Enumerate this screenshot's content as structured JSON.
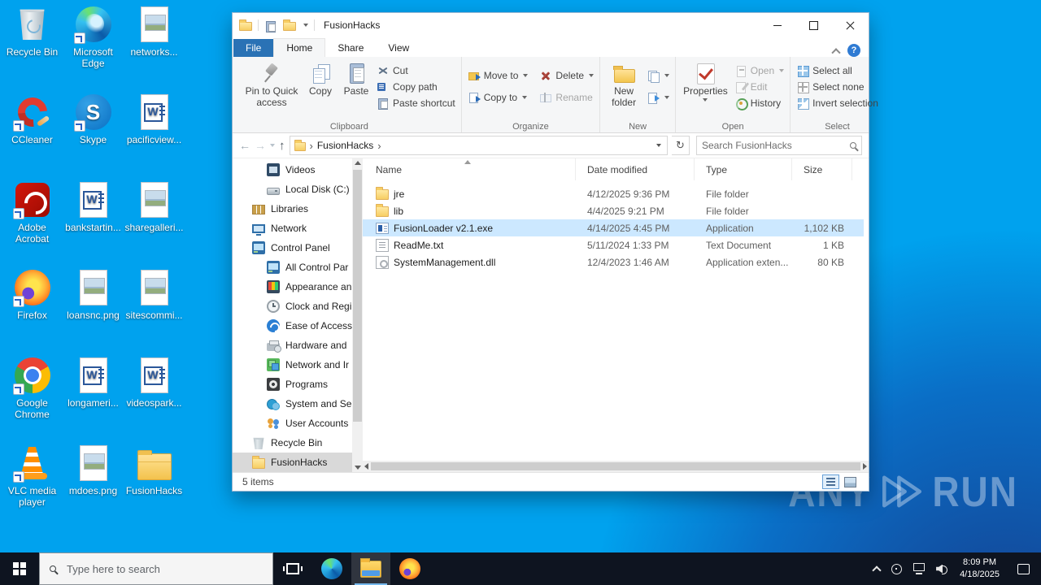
{
  "desktop": {
    "icons": [
      {
        "label": "Recycle Bin",
        "icon": "recycle-bin"
      },
      {
        "label": "Microsoft Edge",
        "icon": "edge",
        "state": "shortcut"
      },
      {
        "label": "networks...",
        "icon": "image"
      },
      {
        "label": "CCleaner",
        "icon": "ccleaner",
        "state": "shortcut"
      },
      {
        "label": "Skype",
        "icon": "skype",
        "state": "shortcut"
      },
      {
        "label": "pacificview...",
        "icon": "word"
      },
      {
        "label": "Adobe Acrobat",
        "icon": "acrobat",
        "state": "shortcut"
      },
      {
        "label": "bankstartin...",
        "icon": "word"
      },
      {
        "label": "sharegalleri...",
        "icon": "image"
      },
      {
        "label": "Firefox",
        "icon": "firefox",
        "state": "shortcut"
      },
      {
        "label": "loansnc.png",
        "icon": "image"
      },
      {
        "label": "sitescommi...",
        "icon": "image"
      },
      {
        "label": "Google Chrome",
        "icon": "chrome",
        "state": "shortcut"
      },
      {
        "label": "longameri...",
        "icon": "word"
      },
      {
        "label": "videospark...",
        "icon": "word"
      },
      {
        "label": "VLC media player",
        "icon": "vlc",
        "state": "shortcut"
      },
      {
        "label": "mdoes.png",
        "icon": "image"
      },
      {
        "label": "FusionHacks",
        "icon": "folder"
      }
    ]
  },
  "window": {
    "title": "FusionHacks",
    "help": "?",
    "tabs": {
      "file": "File",
      "home": "Home",
      "share": "Share",
      "view": "View"
    },
    "ribbon": {
      "clipboard": {
        "label": "Clipboard",
        "pin": {
          "label": "Pin to Quick access",
          "icon": "pin"
        },
        "copy": {
          "label": "Copy",
          "icon": "copy-pages"
        },
        "paste": {
          "label": "Paste",
          "icon": "clipboard-paste"
        },
        "cut": {
          "label": "Cut",
          "icon": "scissors"
        },
        "copy_path": {
          "label": "Copy path",
          "icon": "copy-path"
        },
        "paste_shortcut": {
          "label": "Paste shortcut",
          "icon": "paste-shortcut"
        }
      },
      "organize": {
        "label": "Organize",
        "move_to": {
          "label": "Move to",
          "icon": "move-to-folder"
        },
        "copy_to": {
          "label": "Copy to",
          "icon": "copy-to-folder"
        },
        "delete": {
          "label": "Delete",
          "icon": "delete-x"
        },
        "rename": {
          "label": "Rename",
          "icon": "rename-field"
        }
      },
      "new": {
        "label": "New",
        "new_folder": {
          "label": "New folder",
          "icon": "new-folder"
        },
        "new_item_icon": "new-item",
        "easy_access_icon": "easy-access"
      },
      "open": {
        "label": "Open",
        "properties": {
          "label": "Properties",
          "icon": "properties-check"
        },
        "open": {
          "label": "Open",
          "icon": "open-file"
        },
        "edit": {
          "label": "Edit",
          "icon": "edit-pencil"
        },
        "history": {
          "label": "History",
          "icon": "history-clock"
        }
      },
      "select": {
        "label": "Select",
        "select_all": {
          "label": "Select all",
          "icon": "grid-filled"
        },
        "select_none": {
          "label": "Select none",
          "icon": "grid-outline"
        },
        "invert": {
          "label": "Invert selection",
          "icon": "grid-half"
        }
      }
    },
    "address": {
      "crumb": "FusionHacks",
      "search_placeholder": "Search FusionHacks"
    },
    "nav": {
      "items": [
        {
          "label": "Videos",
          "icon": "videos",
          "state": "lvl2"
        },
        {
          "label": "Local Disk (C:)",
          "icon": "disk",
          "state": "lvl2"
        },
        {
          "label": "Libraries",
          "icon": "libraries",
          "state": "lvl1"
        },
        {
          "label": "Network",
          "icon": "network",
          "state": "lvl1"
        },
        {
          "label": "Control Panel",
          "icon": "control-panel",
          "state": "lvl1"
        },
        {
          "label": "All Control Par",
          "icon": "control-panel",
          "state": "lvl2"
        },
        {
          "label": "Appearance an",
          "icon": "appearance",
          "state": "lvl2"
        },
        {
          "label": "Clock and Regi",
          "icon": "clock",
          "state": "lvl2"
        },
        {
          "label": "Ease of Access",
          "icon": "ease",
          "state": "lvl2"
        },
        {
          "label": "Hardware and",
          "icon": "hardware",
          "state": "lvl2"
        },
        {
          "label": "Network and Ir",
          "icon": "network-internet",
          "state": "lvl2"
        },
        {
          "label": "Programs",
          "icon": "programs",
          "state": "lvl2"
        },
        {
          "label": "System and Se",
          "icon": "system",
          "state": "lvl2"
        },
        {
          "label": "User Accounts",
          "icon": "users",
          "state": "lvl2"
        },
        {
          "label": "Recycle Bin",
          "icon": "recycle-bin-small",
          "state": "lvl1"
        },
        {
          "label": "FusionHacks",
          "icon": "folder",
          "state": "lvl1 selected"
        }
      ]
    },
    "files": {
      "columns": {
        "name": "Name",
        "date": "Date modified",
        "type": "Type",
        "size": "Size"
      },
      "rows": [
        {
          "name": "jre",
          "date": "4/12/2025 9:36 PM",
          "type": "File folder",
          "size": "",
          "icon": "folder"
        },
        {
          "name": "lib",
          "date": "4/4/2025 9:21 PM",
          "type": "File folder",
          "size": "",
          "icon": "folder"
        },
        {
          "name": "FusionLoader v2.1.exe",
          "date": "4/14/2025 4:45 PM",
          "type": "Application",
          "size": "1,102 KB",
          "icon": "exe",
          "state": "selected"
        },
        {
          "name": "ReadMe.txt",
          "date": "5/11/2024 1:33 PM",
          "type": "Text Document",
          "size": "1 KB",
          "icon": "txt"
        },
        {
          "name": "SystemManagement.dll",
          "date": "12/4/2023 1:46 AM",
          "type": "Application exten...",
          "size": "80 KB",
          "icon": "dll"
        }
      ]
    },
    "status": {
      "count": "5 items"
    }
  },
  "taskbar": {
    "search_placeholder": "Type here to search",
    "apps": [
      {
        "icon": "task-view"
      },
      {
        "icon": "edge"
      },
      {
        "icon": "file-explorer",
        "state": "active"
      },
      {
        "icon": "firefox"
      }
    ],
    "clock": {
      "time": "8:09 PM",
      "date": "4/18/2025"
    }
  },
  "watermark": {
    "brand_left": "ANY",
    "brand_right": "RUN"
  }
}
